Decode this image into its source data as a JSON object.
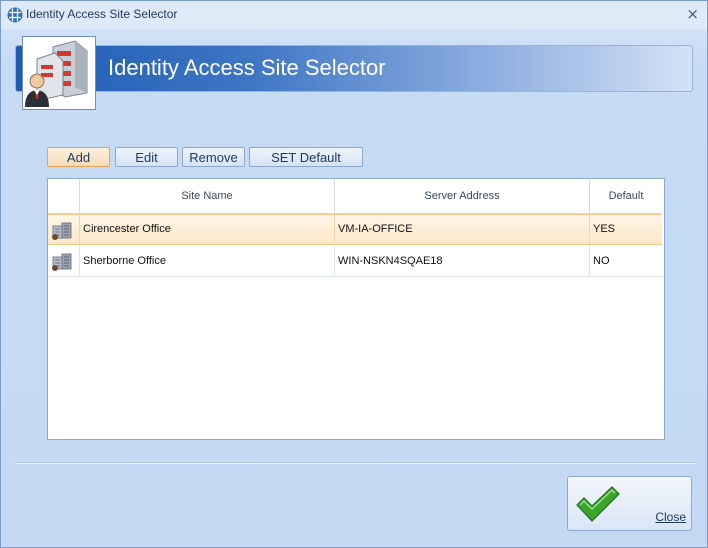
{
  "window": {
    "title": "Identity Access Site Selector",
    "close_glyph": "×",
    "app_icon": "grid-app-icon"
  },
  "banner": {
    "title": "Identity Access Site Selector",
    "image_icon": "buildings-user-icon"
  },
  "toolbar": {
    "add_label": "Add",
    "edit_label": "Edit",
    "remove_label": "Remove",
    "set_default_label": "SET Default"
  },
  "grid": {
    "columns": [
      "",
      "Site Name",
      "Server Address",
      "Default"
    ],
    "rows": [
      {
        "icon": "server-building-icon",
        "site_name": "Cirencester Office",
        "server_address": "VM-IA-OFFICE",
        "default": "YES",
        "selected": true
      },
      {
        "icon": "server-building-icon",
        "site_name": "Sherborne Office",
        "server_address": "WIN-NSKN4SQAE18",
        "default": "NO",
        "selected": false
      }
    ]
  },
  "footer": {
    "close_label": "Close",
    "close_icon": "checkmark-icon"
  },
  "colors": {
    "banner_start": "#1d5bb3",
    "selected_row": "#fde7c6",
    "active_button_border": "#e3a35a",
    "checkmark": "#3aa52b"
  }
}
